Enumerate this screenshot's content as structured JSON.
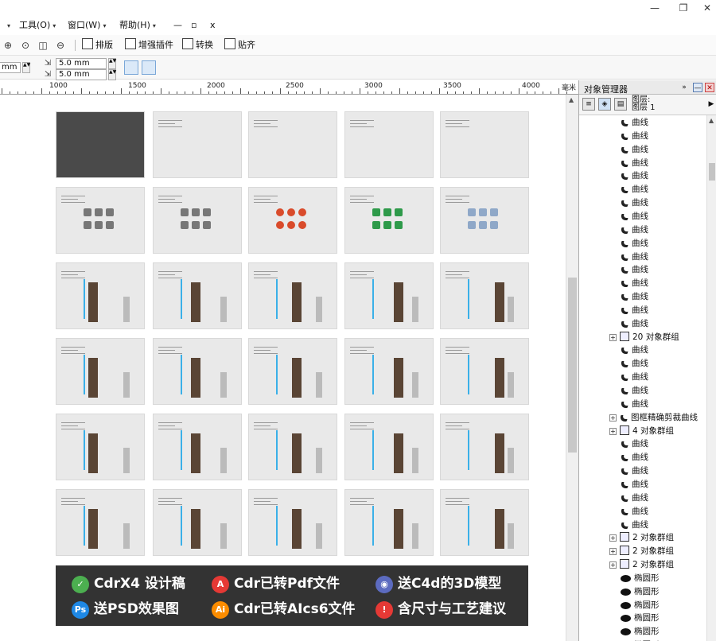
{
  "menu": {
    "items": [
      {
        "label": "工具(O)"
      },
      {
        "label": "窗口(W)"
      },
      {
        "label": "帮助(H)"
      }
    ],
    "window_controls": [
      "—",
      "❐",
      "✕"
    ],
    "mini_controls": [
      "—",
      "▫",
      "x"
    ]
  },
  "toolbar": {
    "buttons": [
      {
        "label": "排版"
      },
      {
        "label": "增强插件"
      },
      {
        "label": "转换"
      },
      {
        "label": "贴齐"
      }
    ]
  },
  "properties": {
    "left_field": "mm",
    "offset_x": "5.0 mm",
    "offset_y": "5.0 mm"
  },
  "ruler": {
    "labels": [
      "1000",
      "1500",
      "2000",
      "2500",
      "3000",
      "3500",
      "4000"
    ],
    "unit": "毫米"
  },
  "banner": {
    "items": [
      {
        "badge": "✓",
        "text": "CdrX4 设计稿",
        "color": "#4caf50"
      },
      {
        "badge": "A",
        "text": "Cdr已转Pdf文件",
        "color": "#e53935"
      },
      {
        "badge": "◉",
        "text": "送C4d的3D模型",
        "color": "#5c6bc0"
      },
      {
        "badge": "Ps",
        "text": "送PSD效果图",
        "color": "#1e88e5"
      },
      {
        "badge": "Ai",
        "text": "Cdr已转AIcs6文件",
        "color": "#fb8c00"
      },
      {
        "badge": "!",
        "text": "含尺寸与工艺建议",
        "color": "#e53935"
      }
    ]
  },
  "object_manager": {
    "title": "对象管理器",
    "layer_label": "图层:",
    "layer_name": "图层 1",
    "tree": [
      {
        "label": "曲线",
        "type": "curve",
        "indent": 2
      },
      {
        "label": "曲线",
        "type": "curve",
        "indent": 2
      },
      {
        "label": "曲线",
        "type": "curve",
        "indent": 2
      },
      {
        "label": "曲线",
        "type": "curve",
        "indent": 2
      },
      {
        "label": "曲线",
        "type": "curve",
        "indent": 2
      },
      {
        "label": "曲线",
        "type": "curve",
        "indent": 2
      },
      {
        "label": "曲线",
        "type": "curve",
        "indent": 2
      },
      {
        "label": "曲线",
        "type": "curve",
        "indent": 2
      },
      {
        "label": "曲线",
        "type": "curve",
        "indent": 2
      },
      {
        "label": "曲线",
        "type": "curve",
        "indent": 2
      },
      {
        "label": "曲线",
        "type": "curve",
        "indent": 2
      },
      {
        "label": "曲线",
        "type": "curve",
        "indent": 2
      },
      {
        "label": "曲线",
        "type": "curve",
        "indent": 2
      },
      {
        "label": "曲线",
        "type": "curve",
        "indent": 2
      },
      {
        "label": "曲线",
        "type": "curve",
        "indent": 2
      },
      {
        "label": "曲线",
        "type": "curve",
        "indent": 2
      },
      {
        "label": "20 对象群组",
        "type": "group",
        "indent": 1
      },
      {
        "label": "曲线",
        "type": "curve",
        "indent": 2
      },
      {
        "label": "曲线",
        "type": "curve",
        "indent": 2
      },
      {
        "label": "曲线",
        "type": "curve",
        "indent": 2
      },
      {
        "label": "曲线",
        "type": "curve",
        "indent": 2
      },
      {
        "label": "曲线",
        "type": "curve",
        "indent": 2
      },
      {
        "label": "图框精确剪裁曲线",
        "type": "powerclip",
        "indent": 1
      },
      {
        "label": "4 对象群组",
        "type": "group",
        "indent": 1
      },
      {
        "label": "曲线",
        "type": "curve",
        "indent": 2
      },
      {
        "label": "曲线",
        "type": "curve",
        "indent": 2
      },
      {
        "label": "曲线",
        "type": "curve",
        "indent": 2
      },
      {
        "label": "曲线",
        "type": "curve",
        "indent": 2
      },
      {
        "label": "曲线",
        "type": "curve",
        "indent": 2
      },
      {
        "label": "曲线",
        "type": "curve",
        "indent": 2
      },
      {
        "label": "曲线",
        "type": "curve",
        "indent": 2
      },
      {
        "label": "2 对象群组",
        "type": "group",
        "indent": 1
      },
      {
        "label": "2 对象群组",
        "type": "group",
        "indent": 1
      },
      {
        "label": "2 对象群组",
        "type": "group",
        "indent": 1
      },
      {
        "label": "椭圆形",
        "type": "ellipse",
        "indent": 2
      },
      {
        "label": "椭圆形",
        "type": "ellipse",
        "indent": 2
      },
      {
        "label": "椭圆形",
        "type": "ellipse",
        "indent": 2
      },
      {
        "label": "椭圆形",
        "type": "ellipse",
        "indent": 2
      },
      {
        "label": "椭圆形",
        "type": "ellipse",
        "indent": 2
      },
      {
        "label": "椭圆形",
        "type": "ellipse",
        "indent": 2
      }
    ]
  },
  "pages": {
    "rows": 6,
    "cols": 5
  }
}
